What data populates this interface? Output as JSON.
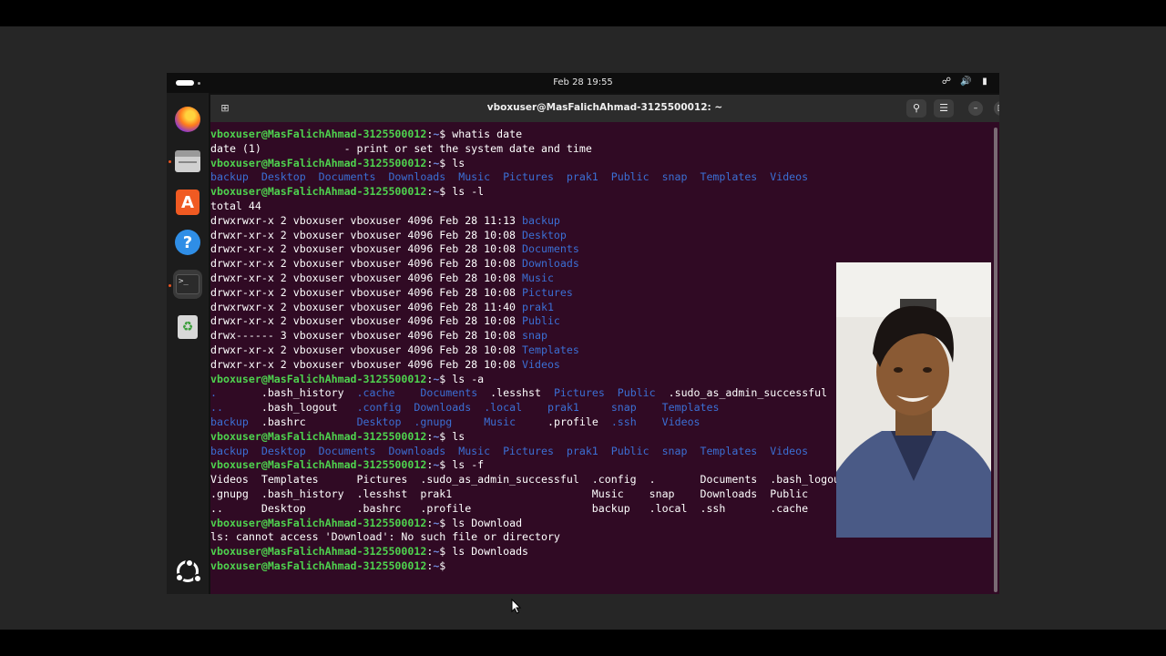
{
  "topbar": {
    "clock": "Feb 28  19:55",
    "tray_icons": [
      "network-icon",
      "volume-icon",
      "battery-icon"
    ]
  },
  "dock": {
    "items": [
      {
        "name": "firefox",
        "icon": "firefox-icon",
        "running": false
      },
      {
        "name": "files",
        "icon": "files-icon",
        "running": true
      },
      {
        "name": "app-center",
        "icon": "app-center-icon",
        "running": false
      },
      {
        "name": "help",
        "icon": "help-icon",
        "running": false
      },
      {
        "name": "terminal",
        "icon": "terminal-icon",
        "running": true,
        "active": true
      },
      {
        "name": "trash",
        "icon": "trash-icon",
        "running": false
      }
    ],
    "show_apps_icon": "ubuntu-logo-icon"
  },
  "window": {
    "title": "vboxuser@MasFalichAhmad-3125500012: ~",
    "buttons": {
      "new_tab": "new-tab-icon",
      "search": "search-icon",
      "menu": "hamburger-icon",
      "minimize": "minimize-icon",
      "maximize": "maximize-icon",
      "close": "close-icon"
    }
  },
  "terminal": {
    "prompt_user": "vboxuser@MasFalichAhmad-3125500012",
    "prompt_path": "~",
    "lines": [
      {
        "kind": "cmd",
        "cmd": "whatis date"
      },
      {
        "kind": "out",
        "segs": [
          [
            "date (1)             - print or set the system date and time",
            "n"
          ]
        ]
      },
      {
        "kind": "cmd",
        "cmd": "ls"
      },
      {
        "kind": "out",
        "segs": [
          [
            "backup  Desktop  Documents  Downloads  Music  Pictures  prak1  Public  snap  Templates  Videos",
            "d"
          ]
        ]
      },
      {
        "kind": "cmd",
        "cmd": "ls -l"
      },
      {
        "kind": "out",
        "segs": [
          [
            "total 44",
            "n"
          ]
        ]
      },
      {
        "kind": "out",
        "segs": [
          [
            "drwxrwxr-x 2 vboxuser vboxuser 4096 Feb 28 11:13 ",
            "n"
          ],
          [
            "backup",
            "d"
          ]
        ]
      },
      {
        "kind": "out",
        "segs": [
          [
            "drwxr-xr-x 2 vboxuser vboxuser 4096 Feb 28 10:08 ",
            "n"
          ],
          [
            "Desktop",
            "d"
          ]
        ]
      },
      {
        "kind": "out",
        "segs": [
          [
            "drwxr-xr-x 2 vboxuser vboxuser 4096 Feb 28 10:08 ",
            "n"
          ],
          [
            "Documents",
            "d"
          ]
        ]
      },
      {
        "kind": "out",
        "segs": [
          [
            "drwxr-xr-x 2 vboxuser vboxuser 4096 Feb 28 10:08 ",
            "n"
          ],
          [
            "Downloads",
            "d"
          ]
        ]
      },
      {
        "kind": "out",
        "segs": [
          [
            "drwxr-xr-x 2 vboxuser vboxuser 4096 Feb 28 10:08 ",
            "n"
          ],
          [
            "Music",
            "d"
          ]
        ]
      },
      {
        "kind": "out",
        "segs": [
          [
            "drwxr-xr-x 2 vboxuser vboxuser 4096 Feb 28 10:08 ",
            "n"
          ],
          [
            "Pictures",
            "d"
          ]
        ]
      },
      {
        "kind": "out",
        "segs": [
          [
            "drwxrwxr-x 2 vboxuser vboxuser 4096 Feb 28 11:40 ",
            "n"
          ],
          [
            "prak1",
            "d"
          ]
        ]
      },
      {
        "kind": "out",
        "segs": [
          [
            "drwxr-xr-x 2 vboxuser vboxuser 4096 Feb 28 10:08 ",
            "n"
          ],
          [
            "Public",
            "d"
          ]
        ]
      },
      {
        "kind": "out",
        "segs": [
          [
            "drwx------ 3 vboxuser vboxuser 4096 Feb 28 10:08 ",
            "n"
          ],
          [
            "snap",
            "d"
          ]
        ]
      },
      {
        "kind": "out",
        "segs": [
          [
            "drwxr-xr-x 2 vboxuser vboxuser 4096 Feb 28 10:08 ",
            "n"
          ],
          [
            "Templates",
            "d"
          ]
        ]
      },
      {
        "kind": "out",
        "segs": [
          [
            "drwxr-xr-x 2 vboxuser vboxuser 4096 Feb 28 10:08 ",
            "n"
          ],
          [
            "Videos",
            "d"
          ]
        ]
      },
      {
        "kind": "cmd",
        "cmd": "ls -a"
      },
      {
        "kind": "out",
        "segs": [
          [
            ".",
            "d"
          ],
          [
            "       .bash_history  ",
            "n"
          ],
          [
            ".cache",
            "d"
          ],
          [
            "    ",
            "n"
          ],
          [
            "Documents",
            "d"
          ],
          [
            "  .lesshst  ",
            "n"
          ],
          [
            "Pictures",
            "d"
          ],
          [
            "  ",
            "n"
          ],
          [
            "Public",
            "d"
          ],
          [
            "  .sudo_as_admin_successful",
            "n"
          ]
        ]
      },
      {
        "kind": "out",
        "segs": [
          [
            "..",
            "d"
          ],
          [
            "      .bash_logout   ",
            "n"
          ],
          [
            ".config",
            "d"
          ],
          [
            "  ",
            "n"
          ],
          [
            "Downloads",
            "d"
          ],
          [
            "  ",
            "n"
          ],
          [
            ".local",
            "d"
          ],
          [
            "    ",
            "n"
          ],
          [
            "prak1",
            "d"
          ],
          [
            "     ",
            "n"
          ],
          [
            "snap",
            "d"
          ],
          [
            "    ",
            "n"
          ],
          [
            "Templates",
            "d"
          ]
        ]
      },
      {
        "kind": "out",
        "segs": [
          [
            "backup",
            "d"
          ],
          [
            "  .bashrc        ",
            "n"
          ],
          [
            "Desktop",
            "d"
          ],
          [
            "  ",
            "n"
          ],
          [
            ".gnupg",
            "d"
          ],
          [
            "     ",
            "n"
          ],
          [
            "Music",
            "d"
          ],
          [
            "     .profile  ",
            "n"
          ],
          [
            ".ssh",
            "d"
          ],
          [
            "    ",
            "n"
          ],
          [
            "Videos",
            "d"
          ]
        ]
      },
      {
        "kind": "cmd",
        "cmd": "ls"
      },
      {
        "kind": "out",
        "segs": [
          [
            "backup  Desktop  Documents  Downloads  Music  Pictures  prak1  Public  snap  Templates  Videos",
            "d"
          ]
        ]
      },
      {
        "kind": "cmd",
        "cmd": "ls -f"
      },
      {
        "kind": "out",
        "segs": [
          [
            "Videos  Templates      Pictures  .sudo_as_admin_successful  .config  .       Documents  .bash_logout",
            "n"
          ]
        ]
      },
      {
        "kind": "out",
        "segs": [
          [
            ".gnupg  .bash_history  .lesshst  prak1                      Music    snap    Downloads  Public",
            "n"
          ]
        ]
      },
      {
        "kind": "out",
        "segs": [
          [
            "..      Desktop        .bashrc   .profile                   backup   .local  .ssh       .cache",
            "n"
          ]
        ]
      },
      {
        "kind": "cmd",
        "cmd": "ls Download"
      },
      {
        "kind": "out",
        "segs": [
          [
            "ls: cannot access 'Download': No such file or directory",
            "n"
          ]
        ]
      },
      {
        "kind": "cmd",
        "cmd": "ls Downloads"
      },
      {
        "kind": "cmd",
        "cmd": ""
      }
    ]
  },
  "colors": {
    "terminal_bg": "#300a24",
    "prompt_user": "#4ed24e",
    "prompt_path": "#6e86d8",
    "directory": "#3b6fd4",
    "text": "#ffffff",
    "accent": "#e95420"
  }
}
